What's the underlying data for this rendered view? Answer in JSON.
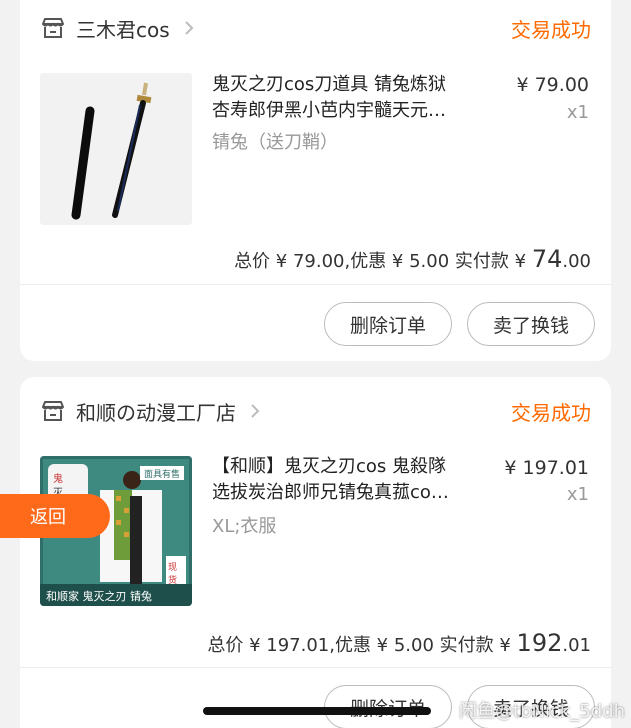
{
  "orders": [
    {
      "shop_name": "三木君cos",
      "status": "交易成功",
      "title_line1": "鬼灭之刃cos刀道具 锖兔炼狱",
      "title_line2": "杏寿郎伊黑小芭内宇髓天元…",
      "sku": "锖兔（送刀鞘）",
      "unit_price": "¥ 79.00",
      "qty": "x1",
      "summary_prefix": "总价 ¥ 79.00,优惠 ¥ 5.00 实付款 ¥ ",
      "paid_int": "74",
      "paid_dec": ".00",
      "delete_label": "删除订单",
      "sell_label": "卖了换钱"
    },
    {
      "shop_name": "和顺の动漫工厂店",
      "status": "交易成功",
      "title_line1": "【和顺】鬼灭之刃cos 鬼殺隊",
      "title_line2": "选拔炭治郎师兄锖兔真菰co…",
      "sku": "XL;衣服",
      "unit_price": "¥ 197.01",
      "qty": "x1",
      "summary_prefix": "总价 ¥ 197.01,优惠 ¥ 5.00 实付款 ¥ ",
      "paid_int": "192",
      "paid_dec": ".01",
      "delete_label": "删除订单",
      "sell_label": "卖了换钱",
      "image_text": {
        "banner": "和顺家 鬼灭之刃 锖兔",
        "corner": "面具有售",
        "tag": "现货"
      }
    }
  ],
  "back_label": "返回",
  "watermark": "闲鱼@tbNick_5ddh",
  "colors": {
    "accent": "#ff6a00",
    "back_tab": "#ff6a1a"
  }
}
